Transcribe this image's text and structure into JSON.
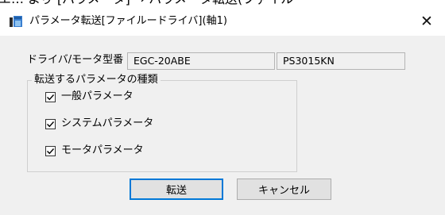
{
  "background_strip": {
    "text": "エ… より [パラメータ] → パラメータ転送(ファイル"
  },
  "window": {
    "title": "パラメータ転送[ファイルードライバ](軸1)",
    "close_symbol": "✕"
  },
  "model": {
    "label": "ドライバ/モータ型番",
    "driver_value": "EGC-20ABE",
    "motor_value": "PS3015KN"
  },
  "params_group": {
    "title": "転送するパラメータの種類",
    "items": [
      {
        "label": "一般パラメータ",
        "checked": true
      },
      {
        "label": "システムパラメータ",
        "checked": true
      },
      {
        "label": "モータパラメータ",
        "checked": true
      }
    ]
  },
  "buttons": {
    "transfer": "転送",
    "cancel": "キャンセル"
  },
  "colors": {
    "dialog_bg": "#f0f0f0",
    "title_bar_bg": "#ffffff",
    "focus_border": "#0078d7"
  },
  "icons": {
    "app": "app-window-icon",
    "close": "close-icon",
    "check": "checkmark-icon"
  }
}
